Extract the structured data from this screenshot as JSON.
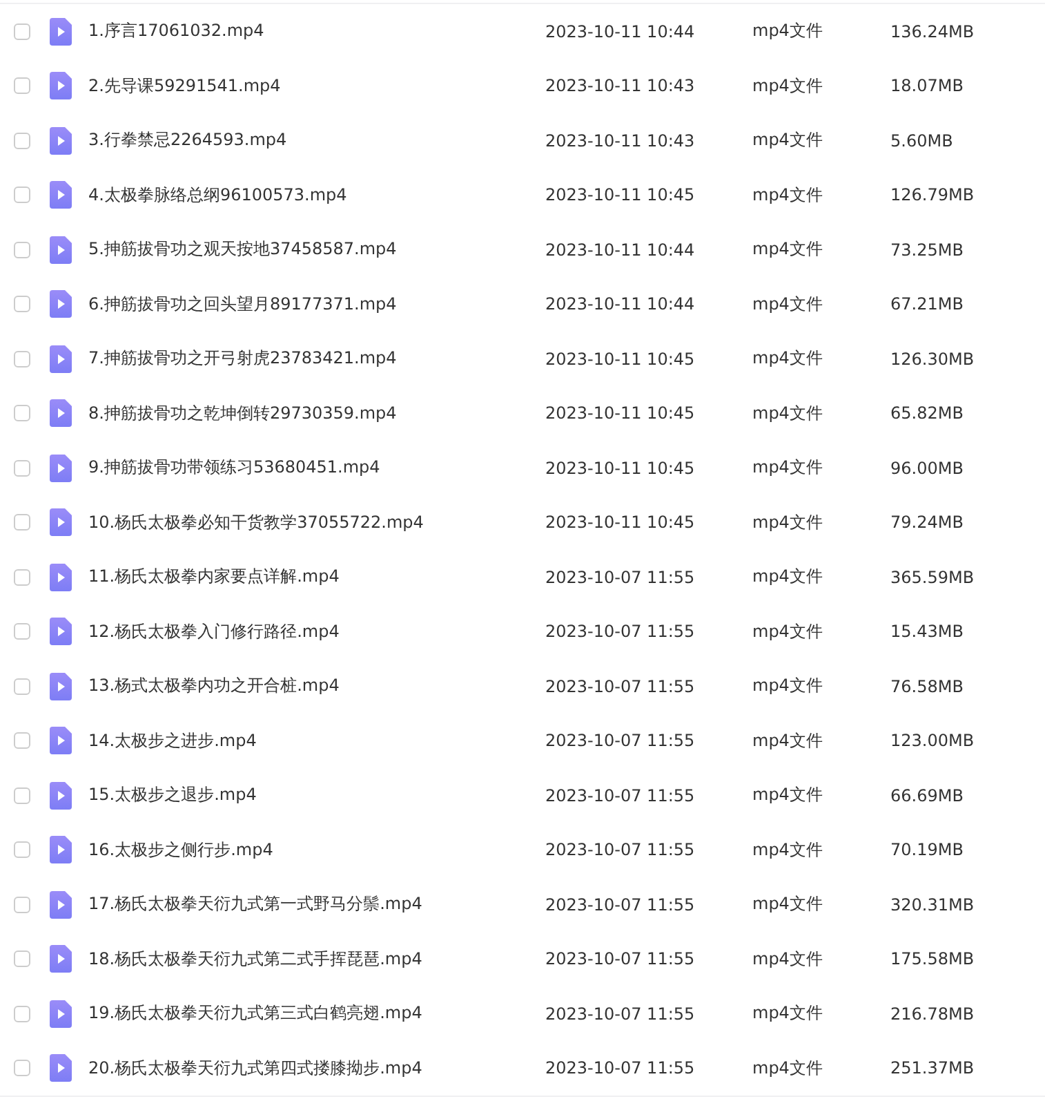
{
  "files": [
    {
      "name": "1.序言17061032.mp4",
      "modified": "2023-10-11 10:44",
      "type": "mp4文件",
      "size": "136.24MB",
      "checked": false
    },
    {
      "name": "2.先导课59291541.mp4",
      "modified": "2023-10-11 10:43",
      "type": "mp4文件",
      "size": "18.07MB",
      "checked": false
    },
    {
      "name": "3.行拳禁忌2264593.mp4",
      "modified": "2023-10-11 10:43",
      "type": "mp4文件",
      "size": "5.60MB",
      "checked": false
    },
    {
      "name": "4.太极拳脉络总纲96100573.mp4",
      "modified": "2023-10-11 10:45",
      "type": "mp4文件",
      "size": "126.79MB",
      "checked": false
    },
    {
      "name": "5.抻筋拔骨功之观天按地37458587.mp4",
      "modified": "2023-10-11 10:44",
      "type": "mp4文件",
      "size": "73.25MB",
      "checked": false
    },
    {
      "name": "6.抻筋拔骨功之回头望月89177371.mp4",
      "modified": "2023-10-11 10:44",
      "type": "mp4文件",
      "size": "67.21MB",
      "checked": false
    },
    {
      "name": "7.抻筋拔骨功之开弓射虎23783421.mp4",
      "modified": "2023-10-11 10:45",
      "type": "mp4文件",
      "size": "126.30MB",
      "checked": false
    },
    {
      "name": "8.抻筋拔骨功之乾坤倒转29730359.mp4",
      "modified": "2023-10-11 10:45",
      "type": "mp4文件",
      "size": "65.82MB",
      "checked": false
    },
    {
      "name": "9.抻筋拔骨功带领练习53680451.mp4",
      "modified": "2023-10-11 10:45",
      "type": "mp4文件",
      "size": "96.00MB",
      "checked": false
    },
    {
      "name": "10.杨氏太极拳必知干货教学37055722.mp4",
      "modified": "2023-10-11 10:45",
      "type": "mp4文件",
      "size": "79.24MB",
      "checked": false
    },
    {
      "name": "11.杨氏太极拳内家要点详解.mp4",
      "modified": "2023-10-07 11:55",
      "type": "mp4文件",
      "size": "365.59MB",
      "checked": false
    },
    {
      "name": "12.杨氏太极拳入门修行路径.mp4",
      "modified": "2023-10-07 11:55",
      "type": "mp4文件",
      "size": "15.43MB",
      "checked": false
    },
    {
      "name": "13.杨式太极拳内功之开合桩.mp4",
      "modified": "2023-10-07 11:55",
      "type": "mp4文件",
      "size": "76.58MB",
      "checked": false
    },
    {
      "name": "14.太极步之进步.mp4",
      "modified": "2023-10-07 11:55",
      "type": "mp4文件",
      "size": "123.00MB",
      "checked": false
    },
    {
      "name": "15.太极步之退步.mp4",
      "modified": "2023-10-07 11:55",
      "type": "mp4文件",
      "size": "66.69MB",
      "checked": false
    },
    {
      "name": "16.太极步之侧行步.mp4",
      "modified": "2023-10-07 11:55",
      "type": "mp4文件",
      "size": "70.19MB",
      "checked": false
    },
    {
      "name": "17.杨氏太极拳天衍九式第一式野马分鬃.mp4",
      "modified": "2023-10-07 11:55",
      "type": "mp4文件",
      "size": "320.31MB",
      "checked": false
    },
    {
      "name": "18.杨氏太极拳天衍九式第二式手挥琵琶.mp4",
      "modified": "2023-10-07 11:55",
      "type": "mp4文件",
      "size": "175.58MB",
      "checked": false
    },
    {
      "name": "19.杨氏太极拳天衍九式第三式白鹤亮翅.mp4",
      "modified": "2023-10-07 11:55",
      "type": "mp4文件",
      "size": "216.78MB",
      "checked": false
    },
    {
      "name": "20.杨氏太极拳天衍九式第四式搂膝拗步.mp4",
      "modified": "2023-10-07 11:55",
      "type": "mp4文件",
      "size": "251.37MB",
      "checked": false
    }
  ]
}
